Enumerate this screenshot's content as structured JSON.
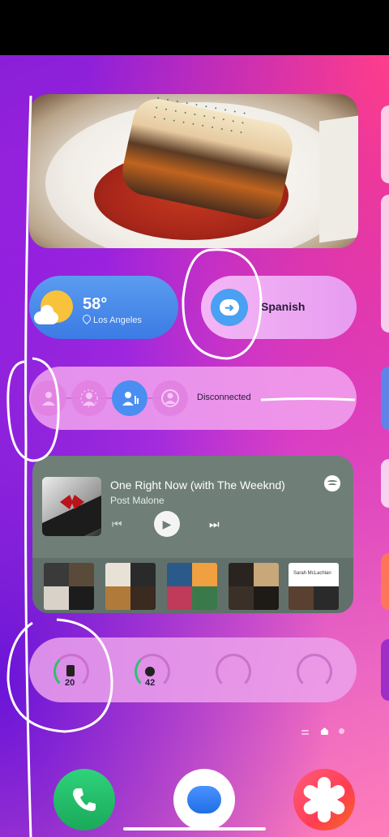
{
  "weather": {
    "temperature": "58°",
    "location": "Los Angeles",
    "icon": "partly-sunny-icon"
  },
  "translate": {
    "label": "Spanish",
    "icon": "translate-bubble-icon",
    "accent": "#4aa0f2"
  },
  "earbuds": {
    "status": "Disconnected",
    "modes": [
      "off",
      "ambient",
      "adaptive",
      "noise-cancel"
    ],
    "active_index": 2
  },
  "music": {
    "title": "One Right Now (with The Weeknd)",
    "artist": "Post Malone",
    "album_tiles": [
      {
        "title": "",
        "colors": [
          "#3a3a3a",
          "#5a4a3a",
          "#d8d2c8",
          "#1c1c1c"
        ]
      },
      {
        "title": "",
        "colors": [
          "#e8e2d6",
          "#2a2a2a",
          "#b07a3a",
          "#3a2a20"
        ]
      },
      {
        "title": "",
        "colors": [
          "#2a5a8a",
          "#f0a040",
          "#c03a5a",
          "#3a7a4a"
        ]
      },
      {
        "title": "",
        "colors": [
          "#2a2420",
          "#c8a878",
          "#3a3028",
          "#1e1a16"
        ]
      },
      {
        "title": "Sarah McLachlan",
        "colors": [
          "#ffffff",
          "#ffffff",
          "#5a4030",
          "#2a2a2a"
        ]
      }
    ]
  },
  "battery": {
    "items": [
      {
        "value": "20",
        "fraction": 0.2,
        "icon": "phone-icon"
      },
      {
        "value": "42",
        "fraction": 0.42,
        "icon": "watch-icon"
      },
      {
        "value": "",
        "fraction": 0,
        "icon": ""
      },
      {
        "value": "",
        "fraction": 0,
        "icon": ""
      }
    ]
  },
  "page_indicator": {
    "current": 2,
    "total": 3
  },
  "dock": [
    {
      "name": "Phone",
      "icon": "phone-handset-icon"
    },
    {
      "name": "Messages",
      "icon": "message-bubble-icon"
    },
    {
      "name": "Gallery",
      "icon": "flower-icon"
    }
  ]
}
